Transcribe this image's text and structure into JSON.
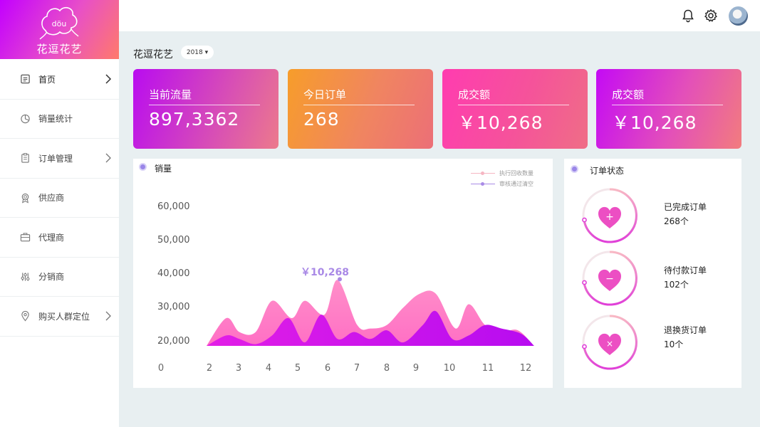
{
  "brand": {
    "logo_glyph": "döu",
    "name": "花逗花艺"
  },
  "sidebar": {
    "items": [
      {
        "label": "首页",
        "icon": "home-icon",
        "chevron": true,
        "active": true
      },
      {
        "label": "销量统计",
        "icon": "pie-chart-icon",
        "chevron": false
      },
      {
        "label": "订单管理",
        "icon": "clipboard-icon",
        "chevron": true
      },
      {
        "label": "供应商",
        "icon": "badge-icon",
        "chevron": false
      },
      {
        "label": "代理商",
        "icon": "briefcase-icon",
        "chevron": false
      },
      {
        "label": "分销商",
        "icon": "sliders-icon",
        "chevron": false
      },
      {
        "label": "购买人群定位",
        "icon": "location-pin-icon",
        "chevron": true
      }
    ]
  },
  "header": {
    "icons": [
      "bell-icon",
      "gear-icon",
      "avatar"
    ]
  },
  "page": {
    "title": "花逗花艺",
    "year": "2018 ▾"
  },
  "stats": [
    {
      "title": "当前流量",
      "value": "897,3362"
    },
    {
      "title": "今日订单",
      "value": "268"
    },
    {
      "title": "成交额",
      "value": "￥10,268"
    },
    {
      "title": "成交额",
      "value": "￥10,268"
    }
  ],
  "sales": {
    "title": "销量",
    "legend": [
      "执行回收数量",
      "审核通过清空"
    ],
    "peak_label": "￥10,268",
    "colors": {
      "series1": "#ff7fcf",
      "series2": "#d414ee",
      "accent": "#9a86e8"
    }
  },
  "chart_data": {
    "type": "area",
    "title": "销量",
    "y_ticks": [
      "60,000",
      "50,000",
      "40,000",
      "30,000",
      "20,000",
      "0"
    ],
    "x_ticks": [
      "2",
      "3",
      "4",
      "5",
      "6",
      "7",
      "8",
      "9",
      "10",
      "11",
      "12"
    ],
    "ylim": [
      20000,
      60000
    ],
    "series": [
      {
        "name": "执行回收数量",
        "x": [
          2,
          2.6,
          3,
          3.5,
          4,
          4.6,
          5,
          5.6,
          6,
          6.6,
          7,
          7.5,
          8,
          8.5,
          9,
          9.6,
          10,
          10.5,
          11,
          11.5,
          12
        ],
        "values": [
          20000,
          28000,
          24000,
          24000,
          33000,
          28000,
          33000,
          29000,
          39000,
          26000,
          25000,
          26000,
          31000,
          35000,
          35000,
          25000,
          32000,
          26000,
          24000,
          24500,
          20000
        ]
      },
      {
        "name": "审核通过清空",
        "x": [
          2,
          2.6,
          3,
          3.5,
          4,
          4.5,
          5,
          5.5,
          6,
          6.5,
          7,
          7.5,
          8,
          8.6,
          9,
          9.5,
          10,
          10.5,
          11,
          11.6,
          12
        ],
        "values": [
          20000,
          23000,
          22000,
          20500,
          23000,
          28000,
          21000,
          29000,
          22000,
          24000,
          22000,
          24500,
          21000,
          26000,
          30000,
          22000,
          23000,
          26000,
          25000,
          23500,
          20000
        ]
      }
    ],
    "peak": {
      "x": 6,
      "y": 39000,
      "label": "￥10,268"
    },
    "legend_position": "top-right"
  },
  "orders": {
    "title": "订单状态",
    "items": [
      {
        "name": "已完成订单",
        "count": "268个",
        "symbol": "+"
      },
      {
        "name": "待付款订单",
        "count": "102个",
        "symbol": "−"
      },
      {
        "name": "退换货订单",
        "count": "10个",
        "symbol": "×"
      }
    ]
  }
}
